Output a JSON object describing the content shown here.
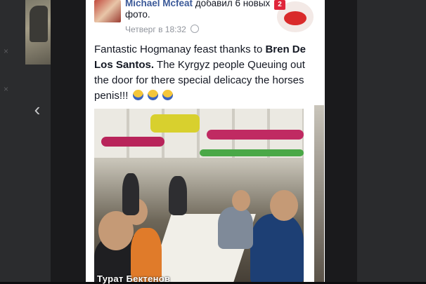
{
  "post": {
    "author": "Michael Mcfeat",
    "action": "добавил 6 новых фото.",
    "timestamp": "Четверг в 18:32",
    "text_before": "Fantastic Hogmanay feast thanks to ",
    "mention": "Bren De Los Santos.",
    "text_after": " The Kyrgyz people Queuing out the door for there special delicacy the horses penis!!!",
    "emojis": [
      "scream-emoji",
      "scream-emoji",
      "scream-emoji"
    ]
  },
  "badge": {
    "count": "2",
    "icon": "lips-icon"
  },
  "viewer": {
    "prev_icon": "chevron-left-icon"
  },
  "caption": "Турат Бектенов",
  "colors": {
    "link": "#3b5998",
    "badge": "#e0263b",
    "viewer_bg": "#1a1a1c"
  }
}
